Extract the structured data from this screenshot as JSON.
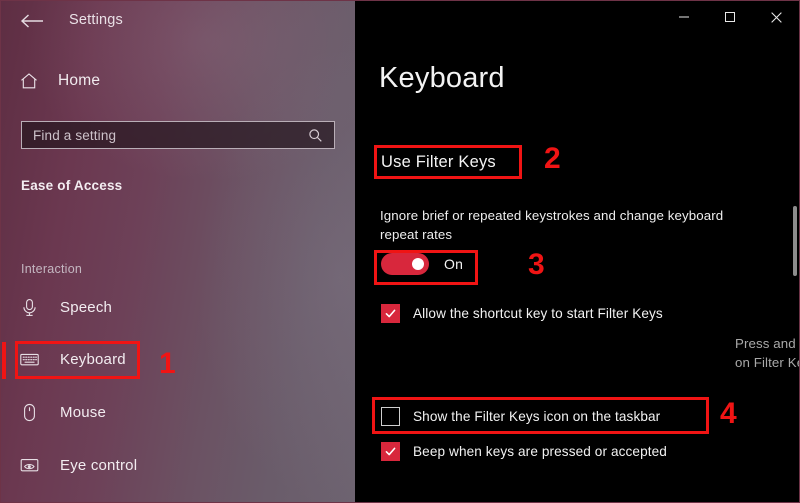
{
  "window": {
    "app_title": "Settings",
    "back_icon": "back-arrow-icon",
    "controls": [
      {
        "name": "minimize",
        "label": "Minimize"
      },
      {
        "name": "maximize",
        "label": "Maximize"
      },
      {
        "name": "close",
        "label": "Close"
      }
    ]
  },
  "sidebar": {
    "home_label": "Home",
    "home_icon": "home-icon",
    "search": {
      "placeholder": "Find a setting",
      "value": "",
      "icon": "search-icon"
    },
    "category": "Ease of Access",
    "group_label": "Interaction",
    "items": [
      {
        "label": "Speech",
        "icon": "microphone-icon",
        "selected": false
      },
      {
        "label": "Keyboard",
        "icon": "keyboard-icon",
        "selected": true
      },
      {
        "label": "Mouse",
        "icon": "mouse-icon",
        "selected": false
      },
      {
        "label": "Eye control",
        "icon": "eye-control-icon",
        "selected": false
      }
    ]
  },
  "main": {
    "page_title": "Keyboard",
    "setting": {
      "heading": "Use Filter Keys",
      "description": "Ignore brief or repeated keystrokes and change keyboard repeat rates",
      "toggle": {
        "state_label": "On",
        "checked": true
      },
      "checkboxes": [
        {
          "label": "Allow the shortcut key to start Filter Keys",
          "checked": true
        },
        {
          "label": "Show the Filter Keys icon on the taskbar",
          "checked": false
        },
        {
          "label": "Beep when keys are pressed or accepted",
          "checked": true
        }
      ],
      "hint": "Press and hold the right Shift key for eight seconds to turn on Filter Keys"
    }
  },
  "annotations": {
    "color": "#f01414",
    "steps": [
      {
        "number": "1",
        "target": "sidebar-item-keyboard"
      },
      {
        "number": "2",
        "target": "use-filter-keys-heading"
      },
      {
        "number": "3",
        "target": "filter-keys-toggle"
      },
      {
        "number": "4",
        "target": "show-taskbar-icon-checkbox"
      }
    ]
  },
  "colors": {
    "accent_red": "#d8273c",
    "annotation_red": "#f01414",
    "panel_background": "#000000",
    "sidebar_left": "#5e2e43",
    "sidebar_right": "#6d6370"
  }
}
